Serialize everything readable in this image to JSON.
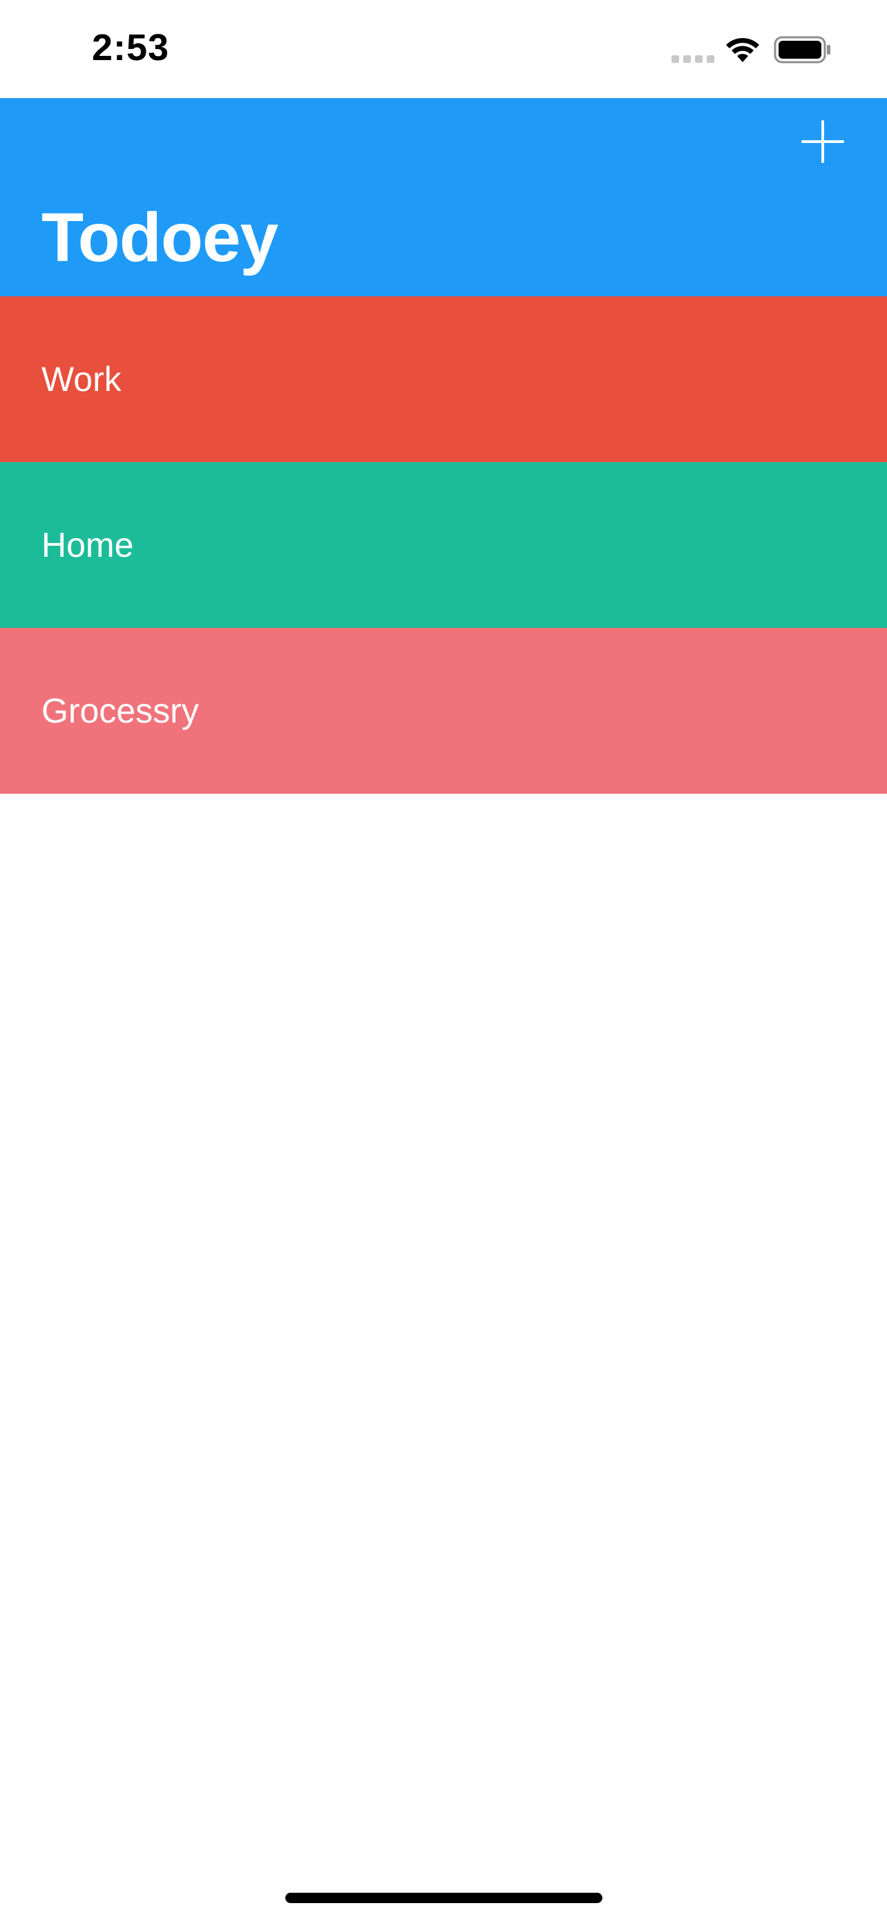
{
  "status_bar": {
    "time": "2:53",
    "signal_icon": "cellular-signal-dots-icon",
    "wifi_icon": "wifi-icon",
    "battery_icon": "battery-full-icon"
  },
  "nav_bar": {
    "title": "Todoey",
    "background_color": "#1f9bf7",
    "add_icon": "plus-icon"
  },
  "categories": [
    {
      "name": "Work",
      "color": "#e84f3c"
    },
    {
      "name": "Home",
      "color": "#1dbc99"
    },
    {
      "name": "Grocessry",
      "color": "#f0737b"
    }
  ]
}
